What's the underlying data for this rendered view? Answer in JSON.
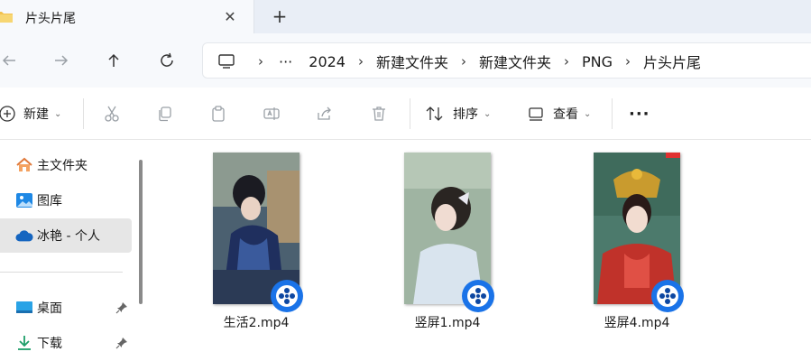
{
  "tab": {
    "title": "片头片尾",
    "close": "✕",
    "new": "+"
  },
  "breadcrumb": {
    "more": "···",
    "items": [
      "2024",
      "新建文件夹",
      "新建文件夹",
      "PNG",
      "片头片尾"
    ],
    "separator": "›"
  },
  "toolbar": {
    "new_label": "新建",
    "sort_label": "排序",
    "view_label": "查看",
    "more": "···"
  },
  "sidebar": {
    "items": [
      {
        "label": "主文件夹",
        "icon": "home-icon"
      },
      {
        "label": "图库",
        "icon": "gallery-icon"
      },
      {
        "label": "冰艳 - 个人",
        "icon": "cloud-icon",
        "selected": true
      },
      {
        "label": "桌面",
        "icon": "desktop-icon",
        "pinned": true
      },
      {
        "label": "下载",
        "icon": "download-icon",
        "pinned": true
      }
    ]
  },
  "files": [
    {
      "name": "生活2.mp4",
      "thumb_theme": "dark-blue"
    },
    {
      "name": "竖屏1.mp4",
      "thumb_theme": "pale-green"
    },
    {
      "name": "竖屏4.mp4",
      "thumb_theme": "red-gold"
    }
  ],
  "colors": {
    "accent": "#0b6cd4",
    "badge": "#1a73e8",
    "selection": "#e6e6e6"
  }
}
